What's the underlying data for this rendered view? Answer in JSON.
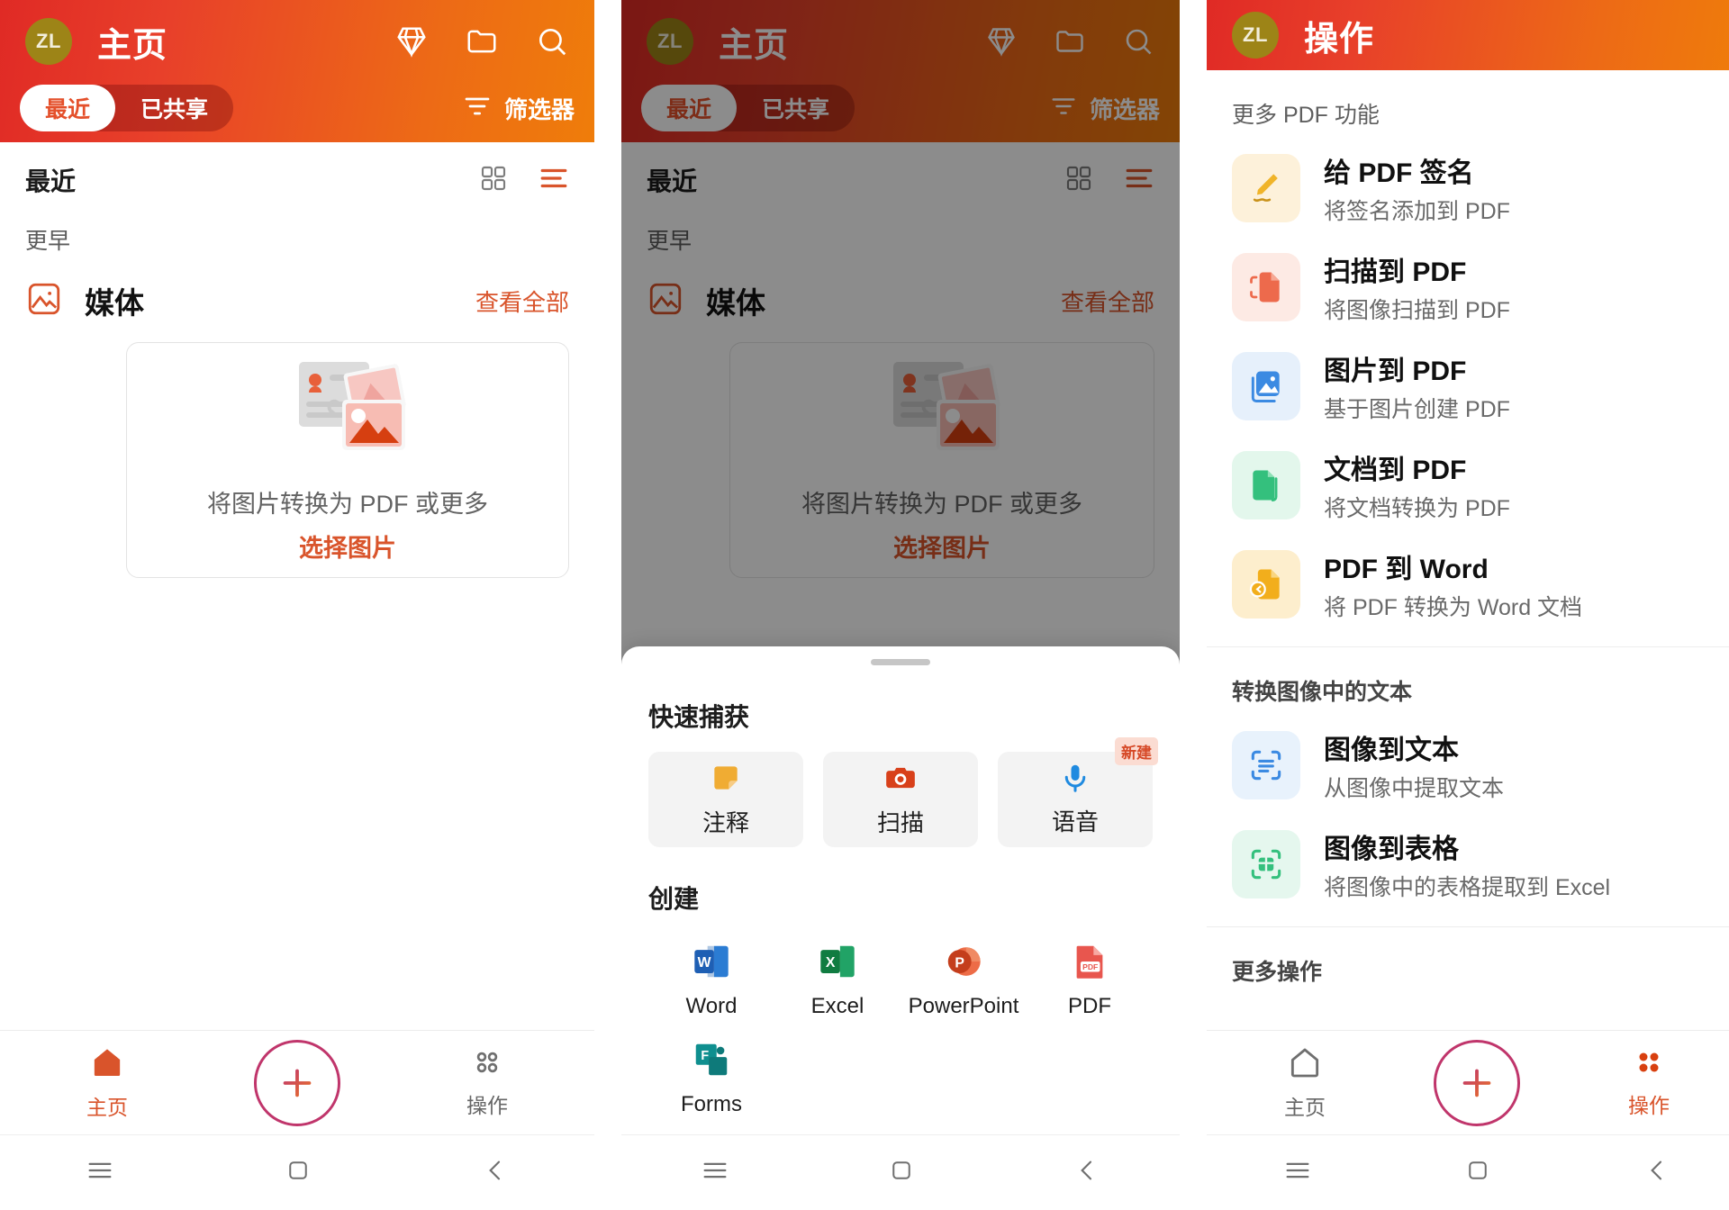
{
  "panel_home": {
    "appbar": {
      "avatar_initials": "ZL",
      "title": "主页",
      "icons": [
        "diamond-icon",
        "folder-icon",
        "search-icon"
      ],
      "segments": [
        {
          "label": "最近",
          "active": true
        },
        {
          "label": "已共享",
          "active": false
        }
      ],
      "filter_label": "筛选器"
    },
    "section": {
      "title": "最近",
      "view_grid_icon": "grid-view-icon",
      "view_list_icon": "list-view-icon",
      "earlier_label": "更早"
    },
    "media": {
      "icon": "image-icon",
      "title": "媒体",
      "see_all": "查看全部",
      "caption": "将图片转换为 PDF 或更多",
      "link": "选择图片"
    },
    "bottom_nav": {
      "home_label": "主页",
      "fab_label": "+",
      "actions_label": "操作",
      "active": "home"
    },
    "sys_nav": [
      "menu-icon",
      "square-icon",
      "back-icon"
    ]
  },
  "panel_create": {
    "appbar": {
      "avatar_initials": "ZL",
      "title": "主页",
      "icons": [
        "diamond-icon",
        "folder-icon",
        "search-icon"
      ],
      "segments": [
        {
          "label": "最近",
          "active": true
        },
        {
          "label": "已共享",
          "active": false
        }
      ],
      "filter_label": "筛选器"
    },
    "section": {
      "title": "最近",
      "earlier_label": "更早"
    },
    "media": {
      "title": "媒体",
      "see_all": "查看全部",
      "caption": "将图片转换为 PDF 或更多",
      "link": "选择图片"
    },
    "sheet": {
      "quick_capture_title": "快速捕获",
      "quick_capture": [
        {
          "label": "注释",
          "icon": "sticky-note-icon",
          "badge": null
        },
        {
          "label": "扫描",
          "icon": "camera-icon",
          "badge": null
        },
        {
          "label": "语音",
          "icon": "microphone-icon",
          "badge": "新建"
        }
      ],
      "create_title": "创建",
      "create": [
        {
          "label": "Word",
          "icon": "word-icon"
        },
        {
          "label": "Excel",
          "icon": "excel-icon"
        },
        {
          "label": "PowerPoint",
          "icon": "powerpoint-icon"
        },
        {
          "label": "PDF",
          "icon": "pdf-icon"
        },
        {
          "label": "Forms",
          "icon": "forms-icon"
        }
      ]
    },
    "sys_nav": [
      "menu-icon",
      "square-icon",
      "back-icon"
    ]
  },
  "panel_actions": {
    "appbar": {
      "avatar_initials": "ZL",
      "title": "操作"
    },
    "groups": [
      {
        "heading": "更多 PDF 功能",
        "items": [
          {
            "title": "给 PDF 签名",
            "subtitle": "将签名添加到 PDF",
            "icon": "signature-icon",
            "icon_bg": "#fdf1da",
            "icon_fg": "#f0b429"
          },
          {
            "title": "扫描到 PDF",
            "subtitle": "将图像扫描到 PDF",
            "icon": "scan-doc-icon",
            "icon_bg": "#fdeae4",
            "icon_fg": "#ed6a4c"
          },
          {
            "title": "图片到 PDF",
            "subtitle": "基于图片创建 PDF",
            "icon": "image-doc-icon",
            "icon_bg": "#e6f0fb",
            "icon_fg": "#3b8ae2"
          },
          {
            "title": "文档到 PDF",
            "subtitle": "将文档转换为 PDF",
            "icon": "doc-convert-icon",
            "icon_bg": "#e3f7ec",
            "icon_fg": "#34c07d"
          },
          {
            "title": "PDF 到 Word",
            "subtitle": "将 PDF 转换为 Word 文档",
            "icon": "pdf-to-word-icon",
            "icon_bg": "#fdeecd",
            "icon_fg": "#f2ae1c"
          }
        ]
      },
      {
        "heading": "转换图像中的文本",
        "items": [
          {
            "title": "图像到文本",
            "subtitle": "从图像中提取文本",
            "icon": "ocr-text-icon",
            "icon_bg": "#e8f2fc",
            "icon_fg": "#3b8ae2"
          },
          {
            "title": "图像到表格",
            "subtitle": "将图像中的表格提取到 Excel",
            "icon": "ocr-table-icon",
            "icon_bg": "#e5f7ee",
            "icon_fg": "#34c07d"
          }
        ]
      },
      {
        "heading": "更多操作",
        "items": []
      }
    ],
    "bottom_nav": {
      "home_label": "主页",
      "fab_label": "+",
      "actions_label": "操作",
      "active": "actions"
    },
    "sys_nav": [
      "menu-icon",
      "square-icon",
      "back-icon"
    ]
  },
  "colors": {
    "brand_red": "#e02a25",
    "brand_orange": "#ef7d0a",
    "accent": "#d9542b",
    "fab_border": "#c0356b"
  }
}
